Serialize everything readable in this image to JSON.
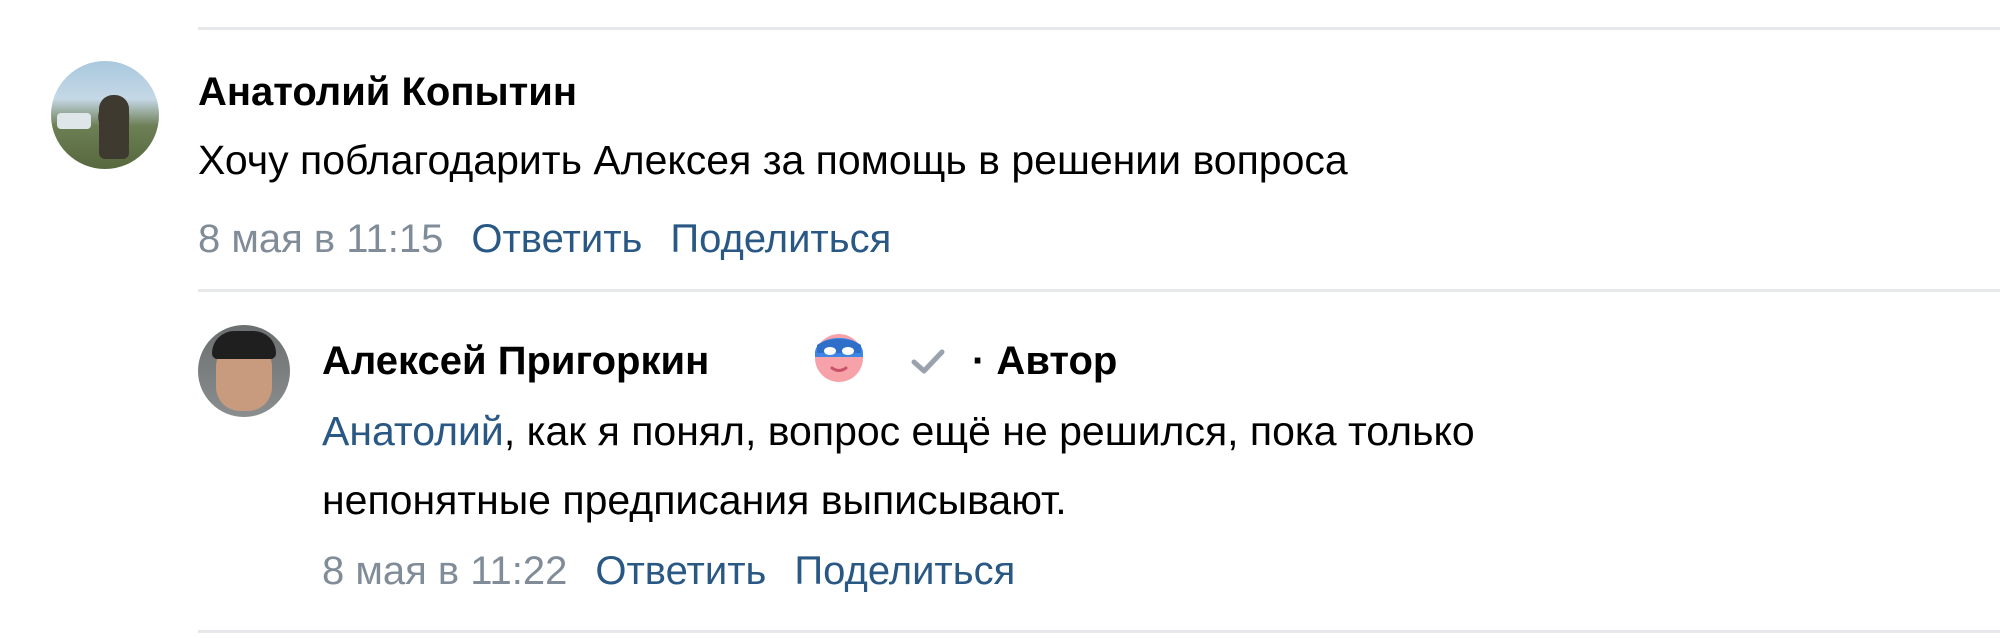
{
  "comment1": {
    "author": "Анатолий Копытин",
    "text": "Хочу поблагодарить Алексея за помощь в решении вопроса",
    "date": "8 мая в 11:15",
    "reply_label": "Ответить",
    "share_label": "Поделиться"
  },
  "comment2": {
    "author": "Алексей Пригоркин",
    "author_tag": "· Автор",
    "badge_icon": "superhero-mask-emoji",
    "verified_icon": "checkmark-icon",
    "mention": "Анатолий",
    "text_line1": ", как я понял, вопрос ещё не решился, пока только",
    "text_line2": "непонятные предписания выписывают.",
    "date": "8 мая в 11:22",
    "reply_label": "Ответить",
    "share_label": "Поделиться"
  },
  "colors": {
    "link": "#2a5885",
    "meta": "#818c99",
    "divider": "#e7e8ec"
  }
}
